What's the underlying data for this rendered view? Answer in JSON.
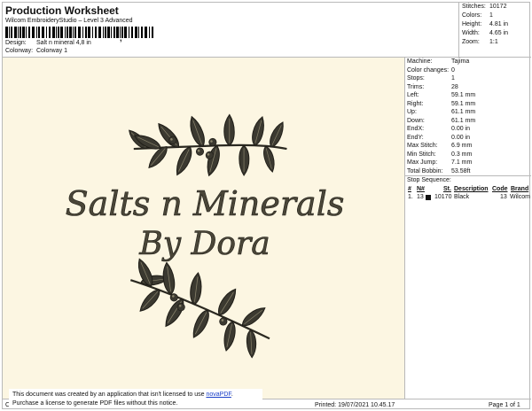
{
  "header": {
    "title": "Production Worksheet",
    "subtitle": "Wilcom EmbroideryStudio – Level 3 Advanced",
    "design_label": "Design:",
    "design_value": "Salt n mineral 4,8 in",
    "colorway_label": "Colorway:",
    "colorway_value": "Colorway 1"
  },
  "stats": [
    {
      "label": "Stitches:",
      "value": "10172"
    },
    {
      "label": "Colors:",
      "value": "1"
    },
    {
      "label": "Height:",
      "value": "4.81 in"
    },
    {
      "label": "Width:",
      "value": "4.65 in"
    },
    {
      "label": "Zoom:",
      "value": "1:1"
    }
  ],
  "design": {
    "line1": "Salts n Minerals",
    "line2": "By Dora"
  },
  "machine_info": [
    {
      "label": "Machine:",
      "value": "Tajima"
    },
    {
      "label": "Color changes:",
      "value": "0"
    },
    {
      "label": "Stops:",
      "value": "1"
    },
    {
      "label": "Trims:",
      "value": "28"
    },
    {
      "label": "Left:",
      "value": "59.1 mm"
    },
    {
      "label": "Right:",
      "value": "59.1 mm"
    },
    {
      "label": "Up:",
      "value": "61.1 mm"
    },
    {
      "label": "Down:",
      "value": "61.1 mm"
    },
    {
      "label": "EndX:",
      "value": "0.00 in"
    },
    {
      "label": "EndY:",
      "value": "0.00 in"
    },
    {
      "label": "Max Stitch:",
      "value": "6.9 mm"
    },
    {
      "label": "Min Stitch:",
      "value": "0.3 mm"
    },
    {
      "label": "Max Jump:",
      "value": "7.1 mm"
    },
    {
      "label": "Total Bobbin:",
      "value": "53.58ft"
    }
  ],
  "stop_sequence": {
    "title": "Stop Sequence:",
    "headers": [
      "#",
      "N#",
      "St.",
      "Description",
      "Code",
      "Brand"
    ],
    "row": {
      "num": "1.",
      "n": "13",
      "stitches": "10170",
      "description": "Black",
      "code": "13",
      "brand": "Wilcom"
    },
    "color": "#111111"
  },
  "footer": {
    "left_fragment": "Cr",
    "printed": "Printed: 19/07/2021 10.45.17",
    "page": "Page 1 of 1"
  },
  "notice": {
    "line1_prefix": "This document was created by an application that isn't licensed to use ",
    "link": "novaPDF",
    "line1_suffix": ".",
    "line2": "Purchase a license to generate PDF files without this notice."
  },
  "colors": {
    "design_background": "#fcf6e2",
    "thread": "#2b2921",
    "link": "#1a3fc8"
  }
}
